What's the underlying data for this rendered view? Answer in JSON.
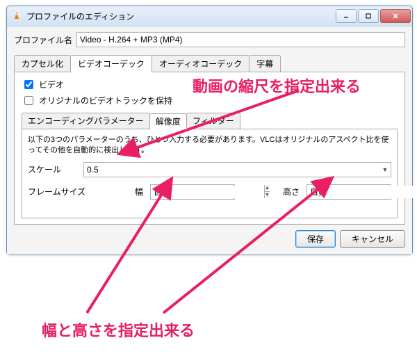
{
  "window": {
    "title": "プロファイルのエディション"
  },
  "profile": {
    "name_label": "プロファイル名",
    "name_value": "Video - H.264 + MP3 (MP4)"
  },
  "tabs": {
    "encapsulation": "カプセル化",
    "video_codec": "ビデオコーデック",
    "audio_codec": "オーディオコーデック",
    "subtitle": "字幕"
  },
  "video": {
    "chk_video": "ビデオ",
    "chk_keep_original": "オリジナルのビデオトラックを保持"
  },
  "subtabs": {
    "encoding": "エンコーディングパラメーター",
    "resolution": "解像度",
    "filter": "フィルター"
  },
  "resolution": {
    "desc": "以下の3つのパラメーターのうち、ひとつ入力する必要があります。VLCはオリジナルのアスペクト比を使ってその他を自動的に検出します。",
    "scale_label": "スケール",
    "scale_value": "0.5",
    "framesize_label": "フレームサイズ",
    "width_label": "幅",
    "width_value": "自動",
    "height_label": "高さ",
    "height_value": "自動"
  },
  "buttons": {
    "save": "保存",
    "cancel": "キャンセル"
  },
  "annotations": {
    "scale": "動画の縮尺を指定出来る",
    "wh": "幅と高さを指定出来る"
  }
}
